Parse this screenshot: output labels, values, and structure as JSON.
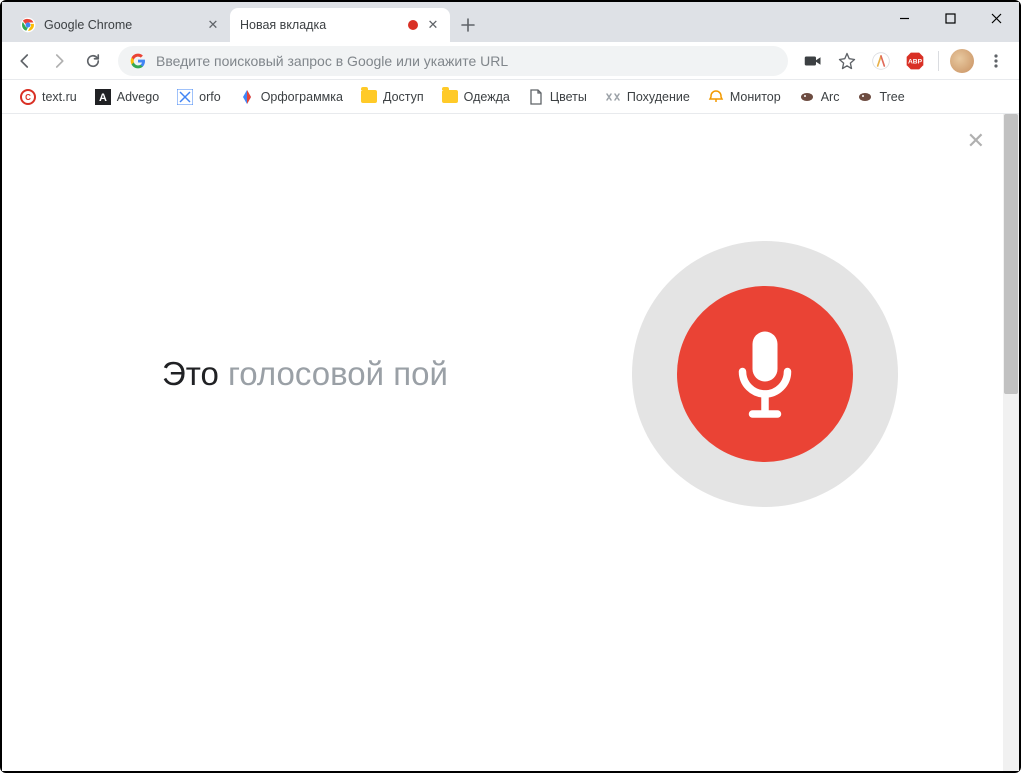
{
  "tabs": [
    {
      "title": "Google Chrome",
      "active": false
    },
    {
      "title": "Новая вкладка",
      "active": true
    }
  ],
  "omnibox": {
    "placeholder": "Введите поисковый запрос в Google или укажите URL"
  },
  "bookmarks": [
    {
      "label": "text.ru"
    },
    {
      "label": "Advego"
    },
    {
      "label": "orfo"
    },
    {
      "label": "Орфограммка"
    },
    {
      "label": "Доступ"
    },
    {
      "label": "Одежда"
    },
    {
      "label": "Цветы"
    },
    {
      "label": "Похудение"
    },
    {
      "label": "Монитор"
    },
    {
      "label": "Arc"
    },
    {
      "label": "Tree"
    }
  ],
  "voice": {
    "text_dark": "Это ",
    "text_light": "голосовой пой"
  }
}
